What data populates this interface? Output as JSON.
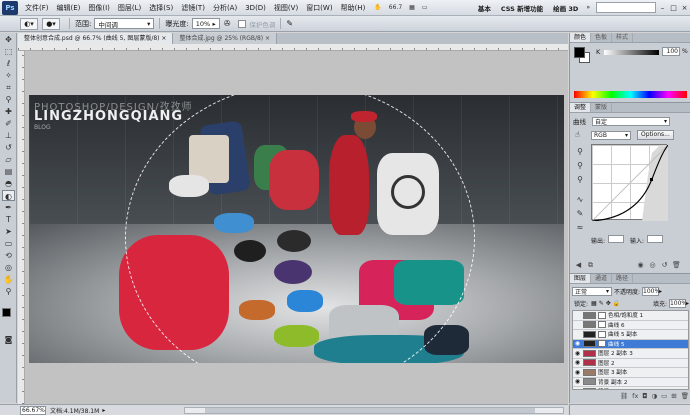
{
  "app": {
    "logo": "Ps",
    "menu": [
      "文件(F)",
      "编辑(E)",
      "图像(I)",
      "图层(L)",
      "选择(S)",
      "滤镜(T)",
      "分析(A)",
      "3D(D)",
      "视图(V)",
      "窗口(W)",
      "帮助(H)"
    ],
    "zoom_menu": "66.7",
    "workspaces": [
      "基本",
      "CSS 新增功能",
      "绘画 3D"
    ],
    "window_controls": [
      "–",
      "□",
      "×"
    ]
  },
  "options": {
    "range_label": "范围:",
    "range_value": "中间调",
    "exposure_label": "曝光度:",
    "exposure_value": "10%",
    "protect_label": "保护色调"
  },
  "documents": {
    "tabs": [
      "整体创意合成.psd @ 66.7% (曲线 5, 图层蒙版/8) ×",
      "整体合成.jpg @ 25% (RGB/8) ×"
    ]
  },
  "canvas": {
    "watermark_line1": "PHOTOSHOP/DESIGN/孜孜师",
    "watermark_line2": "LINGZHONGQIANG",
    "watermark_line3": "BLOG"
  },
  "color_panel": {
    "tabs": [
      "颜色",
      "色板",
      "样式"
    ],
    "channel": "K",
    "value": "100",
    "unit": "%"
  },
  "adjust_panel": {
    "tabs": [
      "调整",
      "蒙版"
    ],
    "title": "曲线",
    "preset": "自定",
    "channel": "RGB",
    "options_btn": "Options...",
    "output_label": "输出:",
    "input_label": "输入:"
  },
  "layers_panel": {
    "tabs": [
      "图层",
      "通道",
      "路径"
    ],
    "blend_mode": "正常",
    "opacity_label": "不透明度:",
    "opacity_value": "100%",
    "lock_label": "锁定:",
    "fill_label": "填充:",
    "fill_value": "100%",
    "layers": [
      {
        "name": "色相/饱和度 1",
        "eye": false,
        "selected": false,
        "mask": true,
        "thumb": "#777777"
      },
      {
        "name": "曲线 6",
        "eye": false,
        "selected": false,
        "mask": true,
        "thumb": "#777777"
      },
      {
        "name": "曲线 5 副本",
        "eye": false,
        "selected": false,
        "mask": true,
        "thumb": "#222222"
      },
      {
        "name": "曲线 5",
        "eye": true,
        "selected": true,
        "mask": true,
        "thumb": "#222222"
      },
      {
        "name": "图层 2 副本 3",
        "eye": true,
        "selected": false,
        "mask": false,
        "thumb": "#b0304a"
      },
      {
        "name": "图层 2",
        "eye": true,
        "selected": false,
        "mask": false,
        "thumb": "#b0304a"
      },
      {
        "name": "图层 3 副本",
        "eye": true,
        "selected": false,
        "mask": false,
        "thumb": "#9a7b6a"
      },
      {
        "name": "背景 副本 2",
        "eye": true,
        "selected": false,
        "mask": false,
        "thumb": "#8a8a8a"
      },
      {
        "name": "背景",
        "eye": true,
        "selected": false,
        "mask": false,
        "thumb": "#555555"
      }
    ],
    "footer_icons": [
      "link-icon",
      "fx-icon",
      "mask-icon",
      "adjust-icon",
      "folder-icon",
      "new-layer-icon",
      "trash-icon"
    ]
  },
  "statusbar": {
    "zoom": "66.67%",
    "doc_info": "文档:4.1M/38.1M"
  },
  "colors": {
    "accent": "#3d7bd6",
    "panel_bg": "#c9ced5"
  }
}
